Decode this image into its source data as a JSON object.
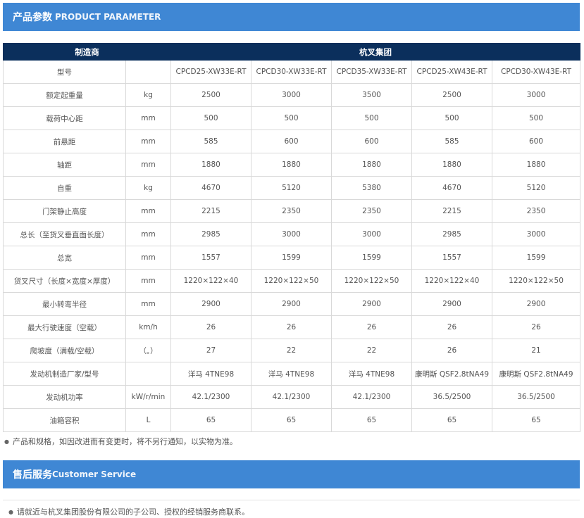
{
  "section1": {
    "title_cn": "产品参数",
    "title_en": "PRODUCT PARAMETER"
  },
  "table": {
    "header_label": "制造商",
    "header_value": "杭叉集团",
    "rows": [
      {
        "name": "型号",
        "unit": "",
        "values": [
          "CPCD25-XW33E-RT",
          "CPCD30-XW33E-RT",
          "CPCD35-XW33E-RT",
          "CPCD25-XW43E-RT",
          "CPCD30-XW43E-RT"
        ]
      },
      {
        "name": "额定起重量",
        "unit": "kg",
        "values": [
          "2500",
          "3000",
          "3500",
          "2500",
          "3000"
        ]
      },
      {
        "name": "载荷中心距",
        "unit": "mm",
        "values": [
          "500",
          "500",
          "500",
          "500",
          "500"
        ]
      },
      {
        "name": "前悬距",
        "unit": "mm",
        "values": [
          "585",
          "600",
          "600",
          "585",
          "600"
        ]
      },
      {
        "name": "轴距",
        "unit": "mm",
        "values": [
          "1880",
          "1880",
          "1880",
          "1880",
          "1880"
        ]
      },
      {
        "name": "自重",
        "unit": "kg",
        "values": [
          "4670",
          "5120",
          "5380",
          "4670",
          "5120"
        ]
      },
      {
        "name": "门架静止高度",
        "unit": "mm",
        "values": [
          "2215",
          "2350",
          "2350",
          "2215",
          "2350"
        ]
      },
      {
        "name": "总长（至货叉垂直面长度）",
        "unit": "mm",
        "values": [
          "2985",
          "3000",
          "3000",
          "2985",
          "3000"
        ]
      },
      {
        "name": "总宽",
        "unit": "mm",
        "values": [
          "1557",
          "1599",
          "1599",
          "1557",
          "1599"
        ]
      },
      {
        "name": "货叉尺寸（长度×宽度×厚度）",
        "unit": "mm",
        "values": [
          "1220×122×40",
          "1220×122×50",
          "1220×122×50",
          "1220×122×40",
          "1220×122×50"
        ]
      },
      {
        "name": "最小转弯半径",
        "unit": "mm",
        "values": [
          "2900",
          "2900",
          "2900",
          "2900",
          "2900"
        ]
      },
      {
        "name": "最大行驶速度（空载）",
        "unit": "km/h",
        "values": [
          "26",
          "26",
          "26",
          "26",
          "26"
        ]
      },
      {
        "name": "爬坡度（满载/空载）",
        "unit": "（。）",
        "values": [
          "27",
          "22",
          "22",
          "26",
          "21"
        ]
      },
      {
        "name": "发动机制造厂家/型号",
        "unit": "",
        "values": [
          "洋马 4TNE98",
          "洋马 4TNE98",
          "洋马 4TNE98",
          "康明斯 QSF2.8tNA49",
          "康明斯 QSF2.8tNA49"
        ]
      },
      {
        "name": "发动机功率",
        "unit": "kW/r/min",
        "values": [
          "42.1/2300",
          "42.1/2300",
          "42.1/2300",
          "36.5/2500",
          "36.5/2500"
        ]
      },
      {
        "name": "油箱容积",
        "unit": "L",
        "values": [
          "65",
          "65",
          "65",
          "65",
          "65"
        ]
      }
    ]
  },
  "note1": "产品和规格，如因改进而有变更时，将不另行通知，以实物为准。",
  "section2": {
    "title_cn": "售后服务",
    "title_en": "Customer Service"
  },
  "note2": "请就近与杭叉集团股份有限公司的子公司、授权的经销服务商联系。",
  "colors": {
    "section_bar": "#3f87d4",
    "table_header": "#0b2f5c",
    "border": "#d9d9d9"
  }
}
